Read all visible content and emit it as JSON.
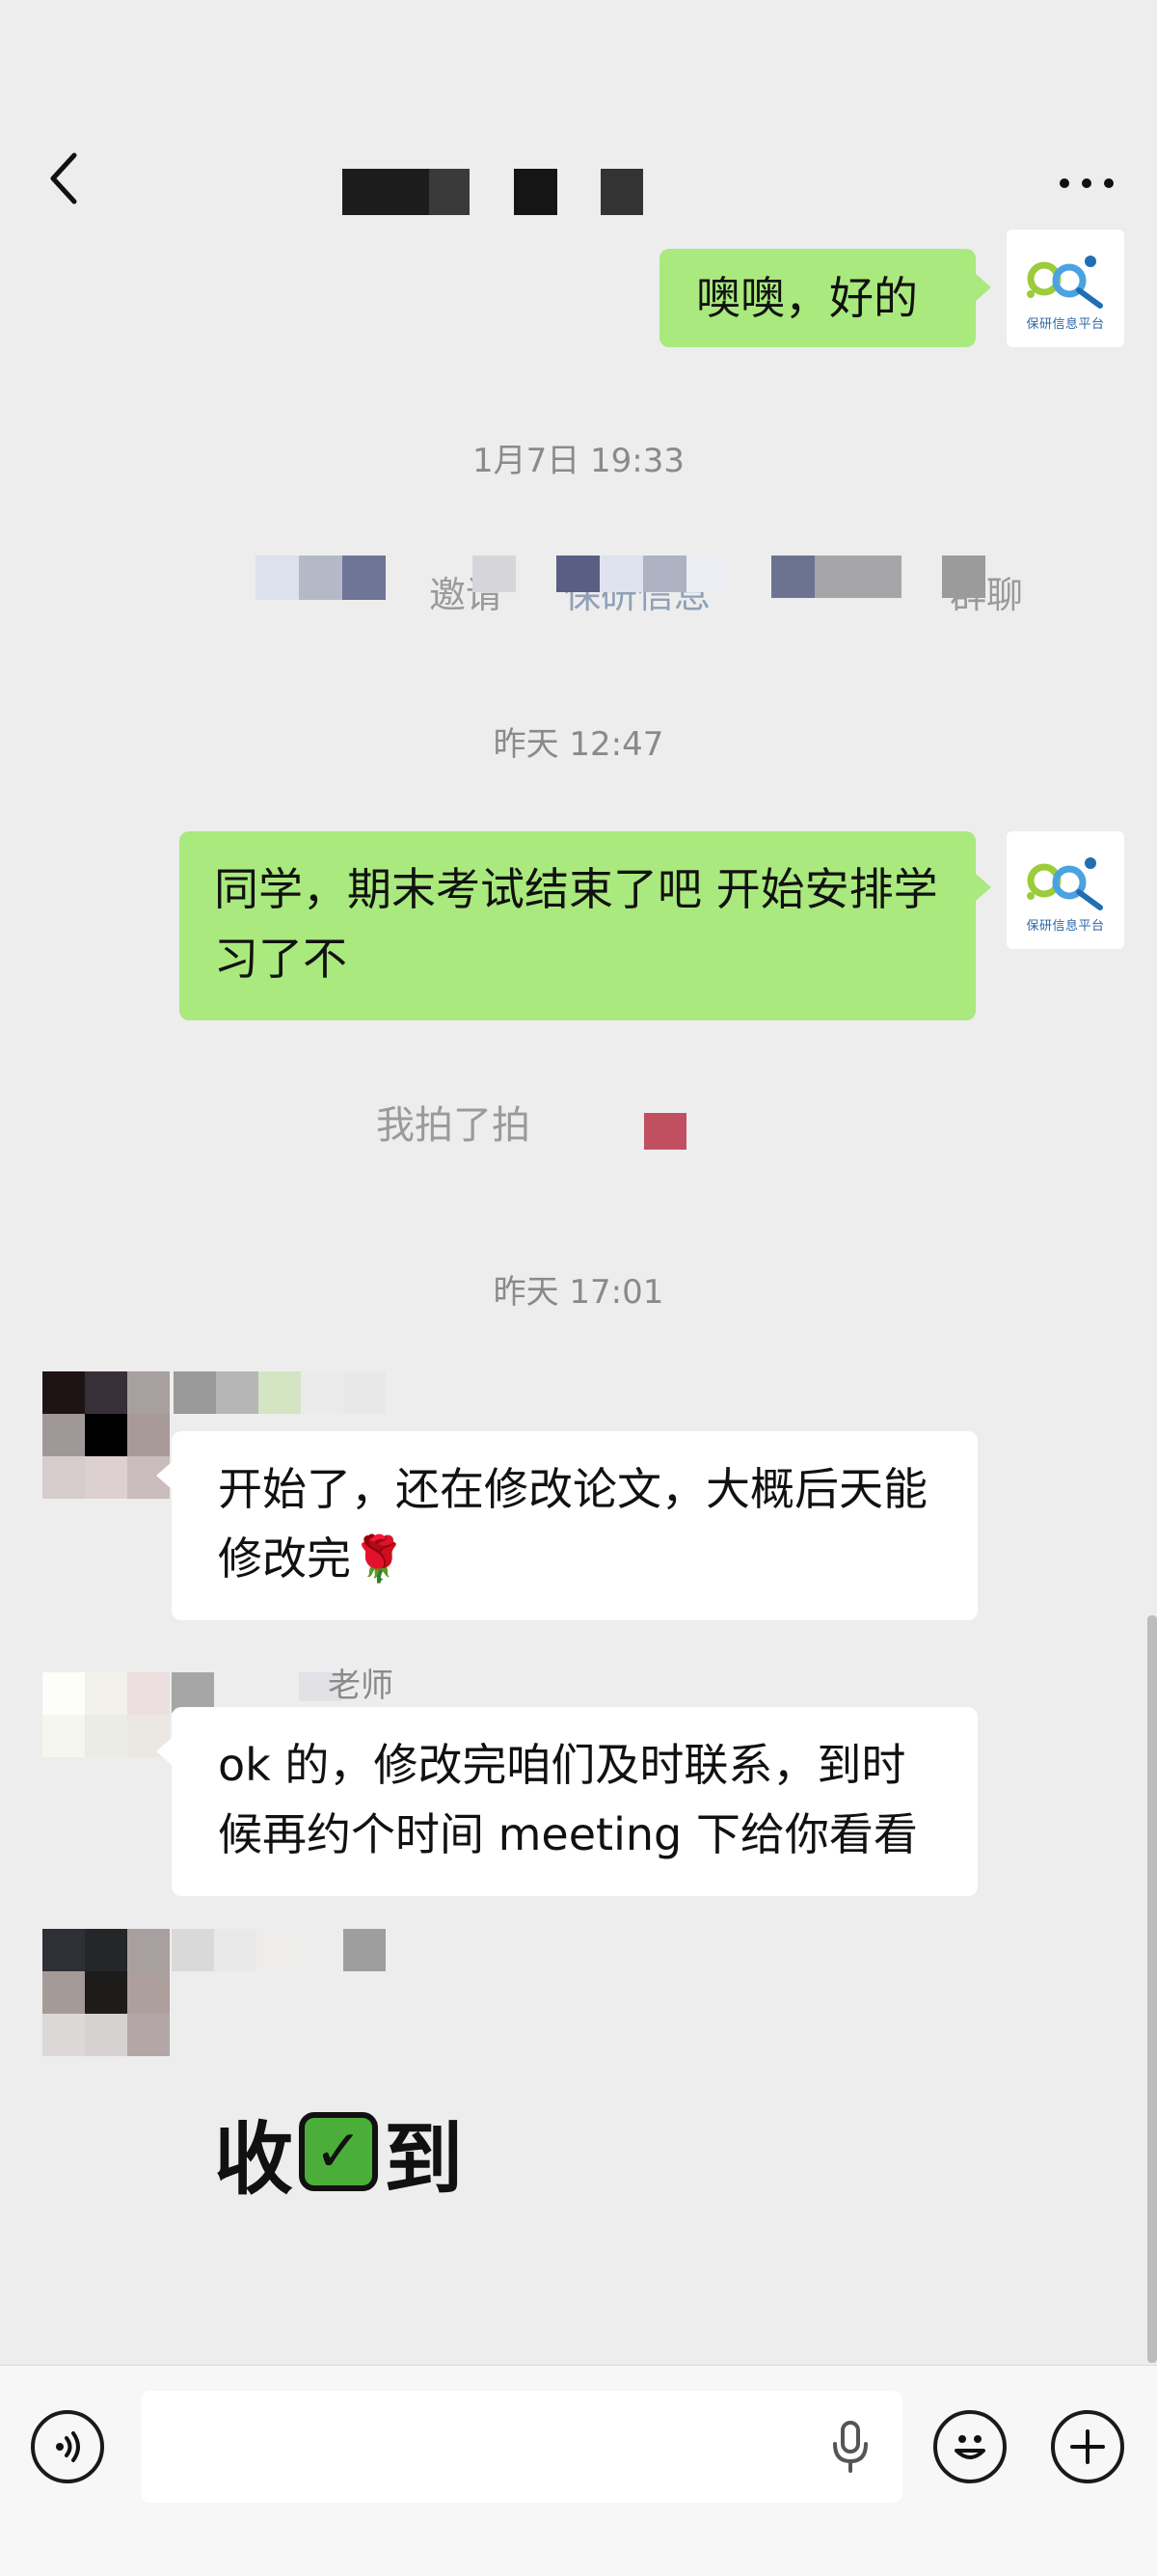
{
  "header": {
    "title": "",
    "back_icon": "chevron-left-icon",
    "more_icon": "more-dots-icon"
  },
  "platform": {
    "caption": "保研信息平台"
  },
  "messages": {
    "m1": "噢噢，好的",
    "ts1": "1月7日 19:33",
    "sys1_prefix": "邀请",
    "sys1_mid": "保研信息",
    "sys1_suffix": "群聊",
    "ts2": "昨天 12:47",
    "m2": "同学，期末考试结束了吧 开始安排学习了不",
    "pat": "我拍了拍",
    "ts3": "昨天 17:01",
    "m3_text": "开始了，还在修改论文，大概后天能修改完",
    "m3_emoji": "🌹",
    "sender2": "老师",
    "m4": "ok 的，修改完咱们及时联系，到时候再约个时间 meeting 下给你看看",
    "sticker_left": "收",
    "sticker_right": "到",
    "sticker_check": "✓"
  },
  "input": {
    "value": "",
    "placeholder": "",
    "voice_icon": "voice-mode-icon",
    "mic_icon": "microphone-icon",
    "emoji_icon": "emoji-icon",
    "plus_icon": "plus-icon"
  },
  "colors": {
    "bubble_out": "#a9e97d",
    "bubble_in": "#ffffff",
    "background": "#ededed"
  }
}
